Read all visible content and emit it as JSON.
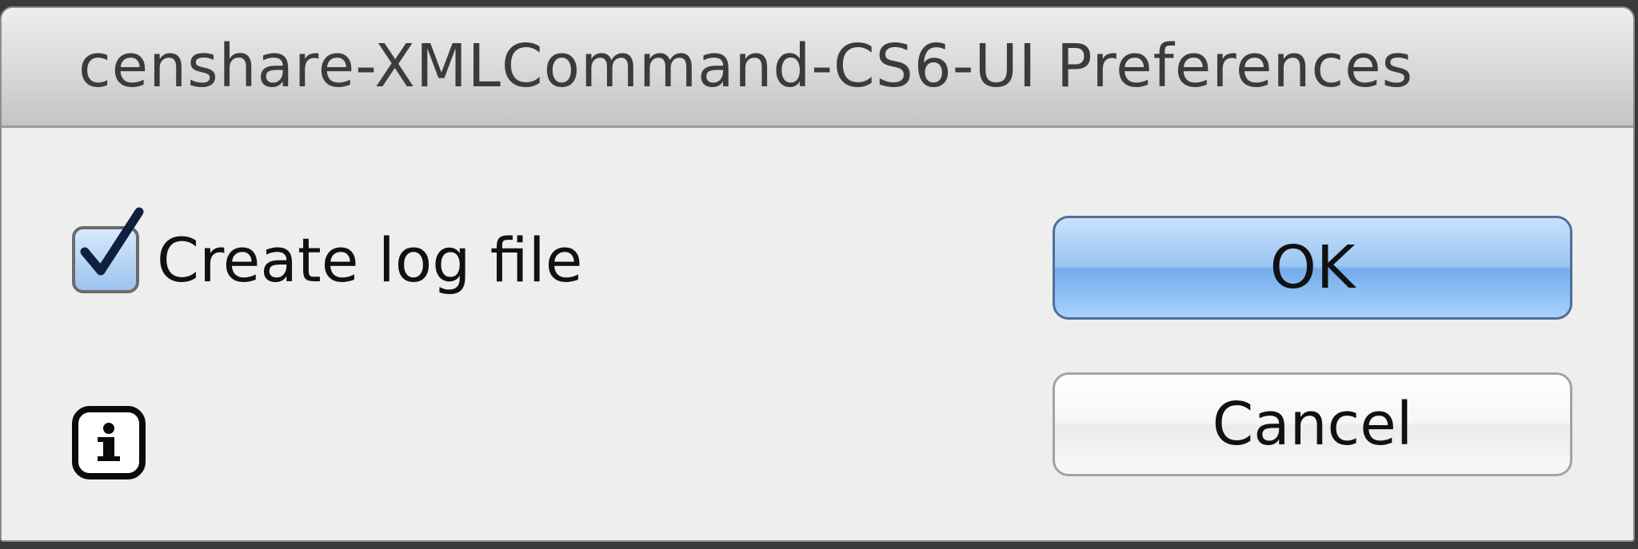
{
  "window": {
    "title": "censhare-XMLCommand-CS6-UI Preferences"
  },
  "options": {
    "create_log_label": "Create log file",
    "create_log_checked": true
  },
  "buttons": {
    "ok_label": "OK",
    "cancel_label": "Cancel"
  },
  "icons": {
    "info": "info-icon",
    "checkmark": "checkmark-icon"
  },
  "colors": {
    "dialog_bg": "#eeeeee",
    "default_button": "#8fc0f2",
    "checkbox_fill": "#b5d3f3"
  }
}
